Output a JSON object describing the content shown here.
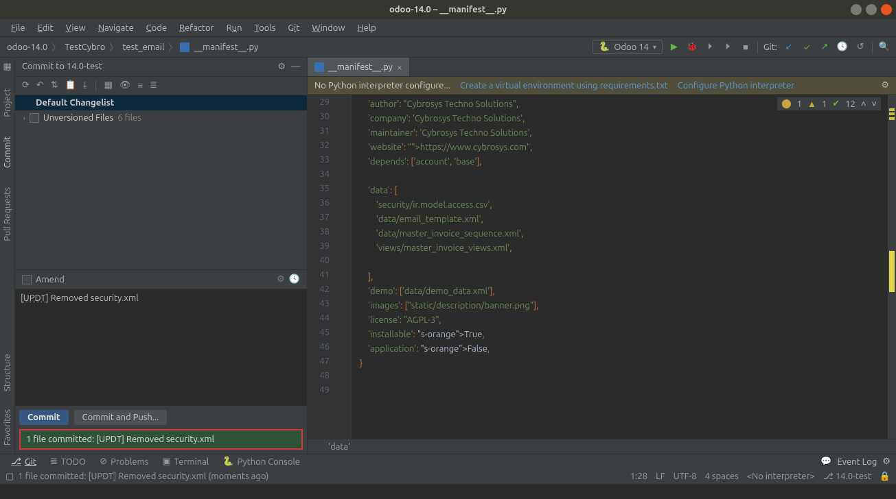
{
  "window": {
    "title": "odoo-14.0 – __manifest__.py"
  },
  "menu": [
    "File",
    "Edit",
    "View",
    "Navigate",
    "Code",
    "Refactor",
    "Run",
    "Tools",
    "Git",
    "Window",
    "Help"
  ],
  "breadcrumb": [
    "odoo-14.0",
    "TestCybro",
    "test_email",
    "__manifest__.py"
  ],
  "run_config": "Odoo 14",
  "git_label": "Git:",
  "left_stripe": {
    "top": [
      "Project",
      "Commit",
      "Pull Requests"
    ],
    "bottom": [
      "Structure",
      "Favorites"
    ]
  },
  "commit_panel": {
    "header": "Commit to 14.0-test",
    "changelist": "Default Changelist",
    "unversioned": "Unversioned Files",
    "file_count": "6 files",
    "amend": "Amend",
    "message_tag": "[UPDT]",
    "message_rest": " Removed security.xml",
    "commit_btn": "Commit",
    "commit_push_btn": "Commit and Push...",
    "notice": "1 file committed: [UPDT] Removed security.xml"
  },
  "editor": {
    "tab_name": "__manifest__.py",
    "banner_msg": "No Python interpreter configure...",
    "banner_link1": "Create a virtual environment using requirements.txt",
    "banner_link2": "Configure Python interpreter",
    "line_start": 29,
    "lines": [
      "    'author': \"Cybrosys Techno Solutions\",",
      "    'company': 'Cybrosys Techno Solutions',",
      "    'maintainer': 'Cybrosys Techno Solutions',",
      "    'website': \"https://www.cybrosys.com\",",
      "    'depends': ['account', 'base'],",
      "",
      "    'data': [",
      "        'security/ir.model.access.csv',",
      "        'data/email_template.xml',",
      "        'data/master_invoice_sequence.xml',",
      "        'views/master_invoice_views.xml',",
      "",
      "    ],",
      "    'demo': ['data/demo_data.xml'],",
      "    'images': [\"static/description/banner.png\"],",
      "    'license': \"AGPL-3\",",
      "    'installable': True,",
      "    'application': False,",
      "}",
      "",
      ""
    ],
    "inspection": {
      "warn": "1",
      "err": "1",
      "typo": "12"
    },
    "breadcrumb": "'data'"
  },
  "bottom_tabs": [
    "Git",
    "TODO",
    "Problems",
    "Terminal",
    "Python Console"
  ],
  "event_log": "Event Log",
  "statusbar": {
    "left": "1 file committed: [UPDT] Removed security.xml (moments ago)",
    "pos": "1:28",
    "le": "LF",
    "enc": "UTF-8",
    "indent": "4 spaces",
    "interp": "<No interpreter>",
    "branch": "14.0-test"
  }
}
